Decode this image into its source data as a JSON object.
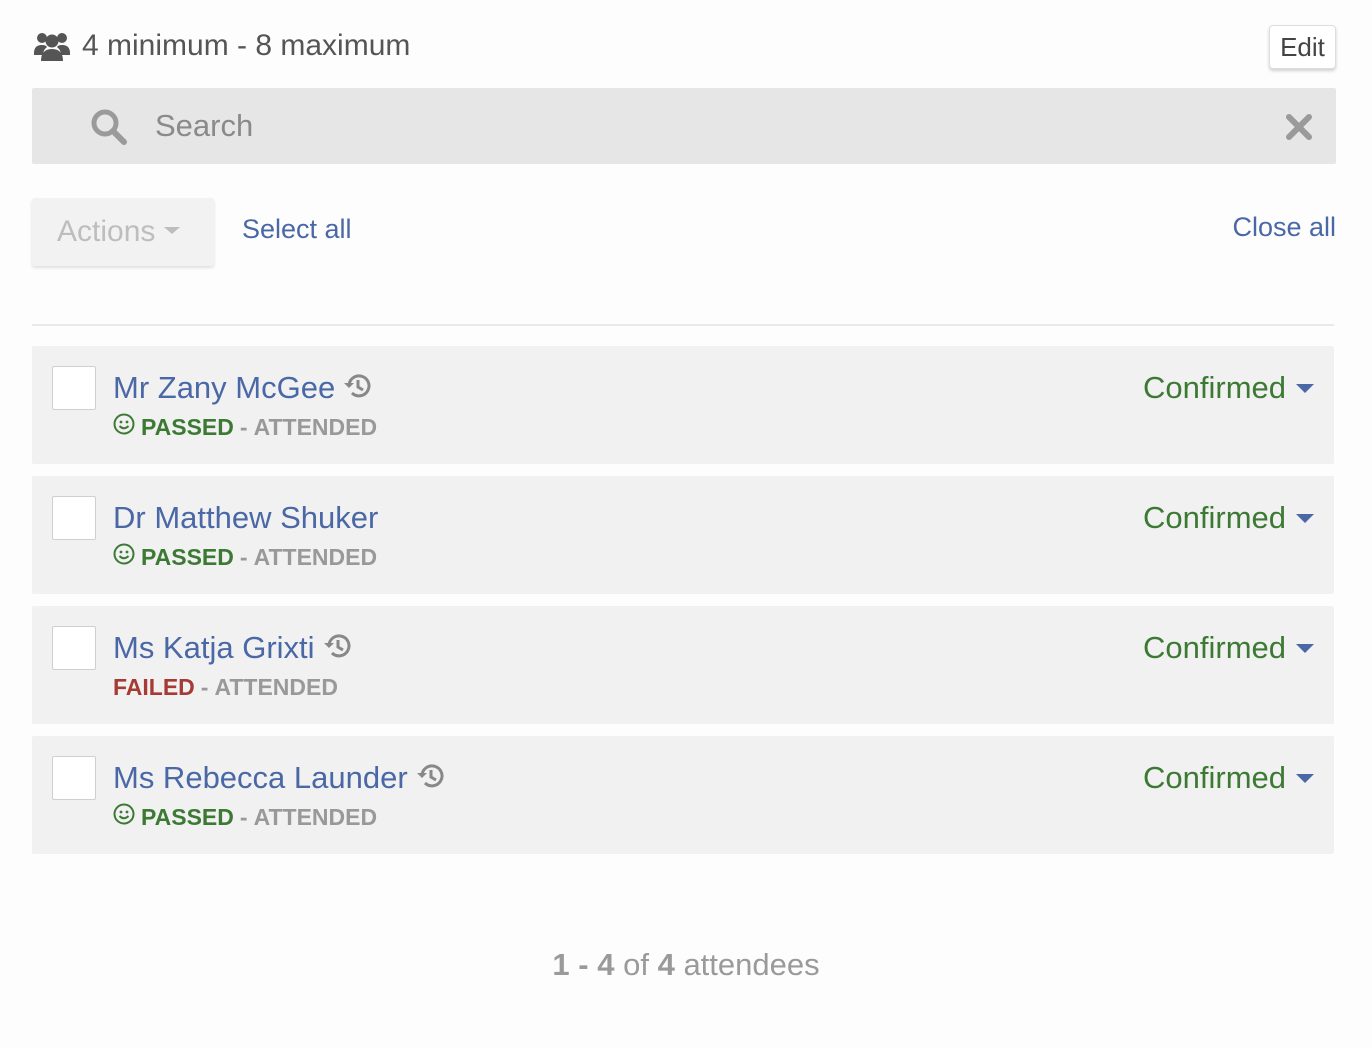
{
  "header": {
    "capacity_text": "4 minimum - 8 maximum",
    "capacity_icon": "users-icon",
    "edit_label": "Edit"
  },
  "search": {
    "placeholder": "Search",
    "search_icon": "search-icon",
    "clear_icon": "close-icon"
  },
  "toolbar": {
    "actions_label": "Actions",
    "select_all_label": "Select all",
    "close_all_label": "Close all"
  },
  "attendees": [
    {
      "name": "Mr Zany McGee",
      "has_history": true,
      "result": "PASSED",
      "separator": "-",
      "attendance": "ATTENDED",
      "status": "Confirmed"
    },
    {
      "name": "Dr Matthew Shuker",
      "has_history": false,
      "result": "PASSED",
      "separator": "-",
      "attendance": "ATTENDED",
      "status": "Confirmed"
    },
    {
      "name": "Ms Katja Grixti",
      "has_history": true,
      "result": "FAILED",
      "separator": "-",
      "attendance": "ATTENDED",
      "status": "Confirmed"
    },
    {
      "name": "Ms Rebecca Launder",
      "has_history": true,
      "result": "PASSED",
      "separator": "-",
      "attendance": "ATTENDED",
      "status": "Confirmed"
    }
  ],
  "pager": {
    "start": "1",
    "dash": "-",
    "end": "4",
    "of": "of",
    "total": "4",
    "unit": "attendees"
  },
  "colors": {
    "link_blue": "#4a67a6",
    "passed_green": "#3c7a34",
    "failed_red": "#a63a34",
    "muted_gray": "#999999"
  }
}
